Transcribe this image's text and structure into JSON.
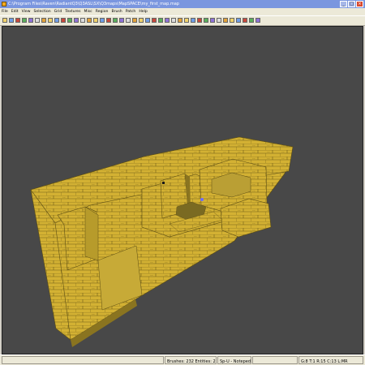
{
  "window": {
    "title": "C:\\Program Files\\Raven\\RadiantQ3\\Q3ASL\\SX\\Q3maps\\MapSPACE\\my_first_map.map",
    "title_controls": [
      "_",
      "□",
      "×"
    ]
  },
  "menubar": {
    "items": [
      "File",
      "Edit",
      "View",
      "Selection",
      "Grid",
      "Textures",
      "Misc",
      "Region",
      "Brush",
      "Patch",
      "Help"
    ]
  },
  "toolbar": {
    "tool_icons": [
      "open-icon",
      "save-icon",
      "cut-icon",
      "copy-icon",
      "paste-icon",
      "flip-x-icon",
      "flip-y-icon",
      "flip-z-icon",
      "rotate-x-icon",
      "rotate-y-icon",
      "rotate-z-icon",
      "select-touching-icon",
      "select-inside-icon",
      "csg-subtract-icon",
      "csg-merge-icon",
      "hollow-icon",
      "clipper-icon",
      "scale-icon",
      "texture-lock-icon",
      "camera-mode-icon",
      "view-change-icon",
      "cubic-clip-icon",
      "entity-list-icon",
      "patch-icon",
      "bend-icon",
      "insert-icon",
      "cap-icon",
      "thicken-icon",
      "lighting-icon",
      "filter-icon",
      "render-mode-icon",
      "grid-icon",
      "show-names-icon",
      "brush-size-icon",
      "build-icon",
      "texture-browser-icon",
      "surface-inspector-icon",
      "shader-icon",
      "help-icon",
      "about-icon"
    ]
  },
  "viewport": {
    "background_color": "#484848",
    "brush_color": "#d3b133",
    "shadow_color": "#8a7420",
    "line_color": "#3a3210"
  },
  "statusbar": {
    "entities_text": "Brushes: 232 Entities: 2",
    "mode_text": "Sp-U - Noteped",
    "grid_text": "G:8 T:1 R:15 C:13 L:MR"
  }
}
